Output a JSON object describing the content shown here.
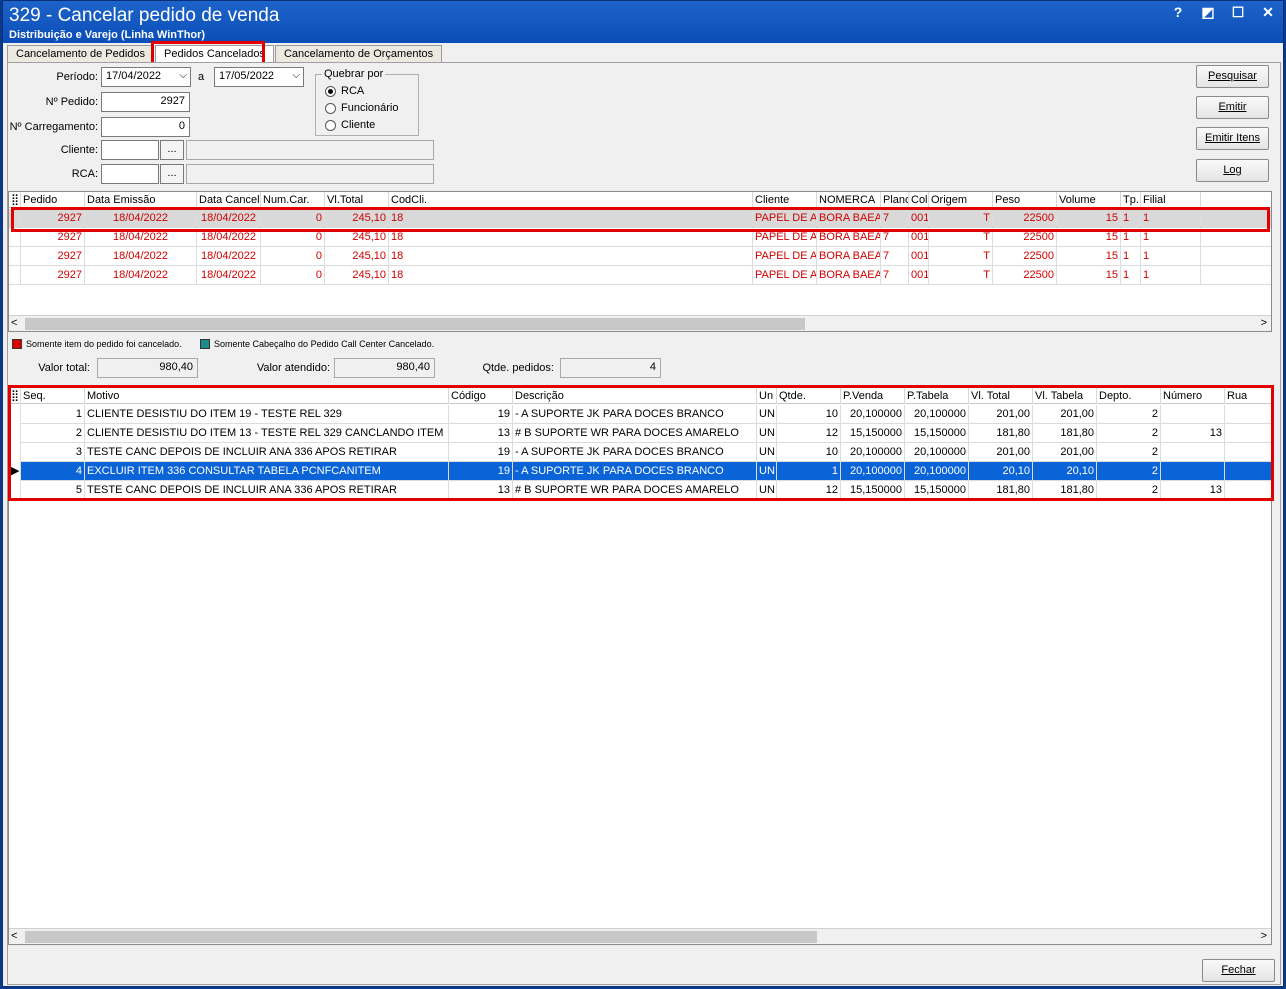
{
  "window": {
    "title": "329 - Cancelar pedido de venda",
    "subtitle": "Distribuição e Varejo (Linha WinThor)",
    "buttons": [
      "?",
      "◩",
      "☐",
      "✕"
    ]
  },
  "tabs": [
    {
      "label": "Cancelamento de Pedidos"
    },
    {
      "label": "Pedidos Cancelados"
    },
    {
      "label": "Cancelamento de Orçamentos"
    }
  ],
  "filters": {
    "periodo_label": "Período:",
    "periodo_inicio": "17/04/2022",
    "a_label": "a",
    "periodo_fim": "17/05/2022",
    "pedido_label": "Nº Pedido:",
    "pedido_value": "2927",
    "carregamento_label": "Nº Carregamento:",
    "carregamento_value": "0",
    "cliente_label": "Cliente:",
    "rca_label": "RCA:",
    "ellipsis": "...",
    "quebrar_title": "Quebrar por",
    "quebrar_options": [
      "RCA",
      "Funcionário",
      "Cliente"
    ],
    "quebrar_selected": "RCA"
  },
  "actions": {
    "pesquisar": "Pesquisar",
    "emitir": "Emitir",
    "emitir_itens": "Emitir Itens",
    "log": "Log",
    "fechar": "Fechar"
  },
  "orders_grid": {
    "columns": [
      "Pedido",
      "Data Emissão",
      "Data Cancel",
      "Num.Car.",
      "Vl.Total",
      "CodCli.",
      "Cliente",
      "NOMERCA",
      "Plano",
      "Col",
      "Origem",
      "Peso",
      "Volume",
      "Tp.",
      "Filial"
    ],
    "rows": [
      [
        "2927",
        "18/04/2022",
        "18/04/2022",
        "0",
        "245,10",
        "18",
        "PAPEL DE AMOSTRA",
        "BORA BAEA",
        "7",
        "001",
        "T",
        "22500",
        "15",
        "1",
        "1"
      ],
      [
        "2927",
        "18/04/2022",
        "18/04/2022",
        "0",
        "245,10",
        "18",
        "PAPEL DE AMOSTRA",
        "BORA BAEA",
        "7",
        "001",
        "T",
        "22500",
        "15",
        "1",
        "1"
      ],
      [
        "2927",
        "18/04/2022",
        "18/04/2022",
        "0",
        "245,10",
        "18",
        "PAPEL DE AMOSTRA",
        "BORA BAEA",
        "7",
        "001",
        "T",
        "22500",
        "15",
        "1",
        "1"
      ],
      [
        "2927",
        "18/04/2022",
        "18/04/2022",
        "0",
        "245,10",
        "18",
        "PAPEL DE AMOSTRA",
        "BORA BAEA",
        "7",
        "001",
        "T",
        "22500",
        "15",
        "1",
        "1"
      ]
    ]
  },
  "legend": {
    "item_cancelado": "Somente item do pedido foi cancelado.",
    "cabecalho_cancelado": "Somente Cabeçalho do Pedido Call Center Cancelado.",
    "item_color": "#e00000",
    "cabecalho_color": "#1a8a8a"
  },
  "totals": {
    "valor_total_label": "Valor total:",
    "valor_total": "980,40",
    "valor_atendido_label": "Valor atendido:",
    "valor_atendido": "980,40",
    "qtde_label": "Qtde. pedidos:",
    "qtde": "4"
  },
  "items_grid": {
    "columns": [
      "Seq.",
      "Motivo",
      "Código",
      "Descrição",
      "Un",
      "Qtde.",
      "P.Venda",
      "P.Tabela",
      "Vl. Total",
      "Vl. Tabela",
      "Depto.",
      "Número",
      "Rua"
    ],
    "rows": [
      [
        "1",
        "CLIENTE DESISTIU DO ITEM 19 - TESTE REL 329",
        "19",
        "- A SUPORTE JK PARA DOCES BRANCO",
        "UN",
        "10",
        "20,100000",
        "20,100000",
        "201,00",
        "201,00",
        "2",
        "",
        ""
      ],
      [
        "2",
        "CLIENTE DESISTIU DO ITEM 13 - TESTE REL 329 CANCLANDO ITEM",
        "13",
        "# B SUPORTE WR PARA DOCES AMARELO",
        "UN",
        "12",
        "15,150000",
        "15,150000",
        "181,80",
        "181,80",
        "2",
        "13",
        ""
      ],
      [
        "3",
        "TESTE CANC DEPOIS DE INCLUIR ANA 336 APOS RETIRAR",
        "19",
        "- A SUPORTE JK PARA DOCES BRANCO",
        "UN",
        "10",
        "20,100000",
        "20,100000",
        "201,00",
        "201,00",
        "2",
        "",
        ""
      ],
      [
        "4",
        "EXCLUIR ITEM 336 CONSULTAR TABELA PCNFCANITEM",
        "19",
        "- A SUPORTE JK PARA DOCES BRANCO",
        "UN",
        "1",
        "20,100000",
        "20,100000",
        "20,10",
        "20,10",
        "2",
        "",
        ""
      ],
      [
        "5",
        "TESTE CANC DEPOIS DE INCLUIR ANA 336 APOS RETIRAR",
        "13",
        "# B SUPORTE WR PARA DOCES AMARELO",
        "UN",
        "12",
        "15,150000",
        "15,150000",
        "181,80",
        "181,80",
        "2",
        "13",
        ""
      ]
    ]
  }
}
